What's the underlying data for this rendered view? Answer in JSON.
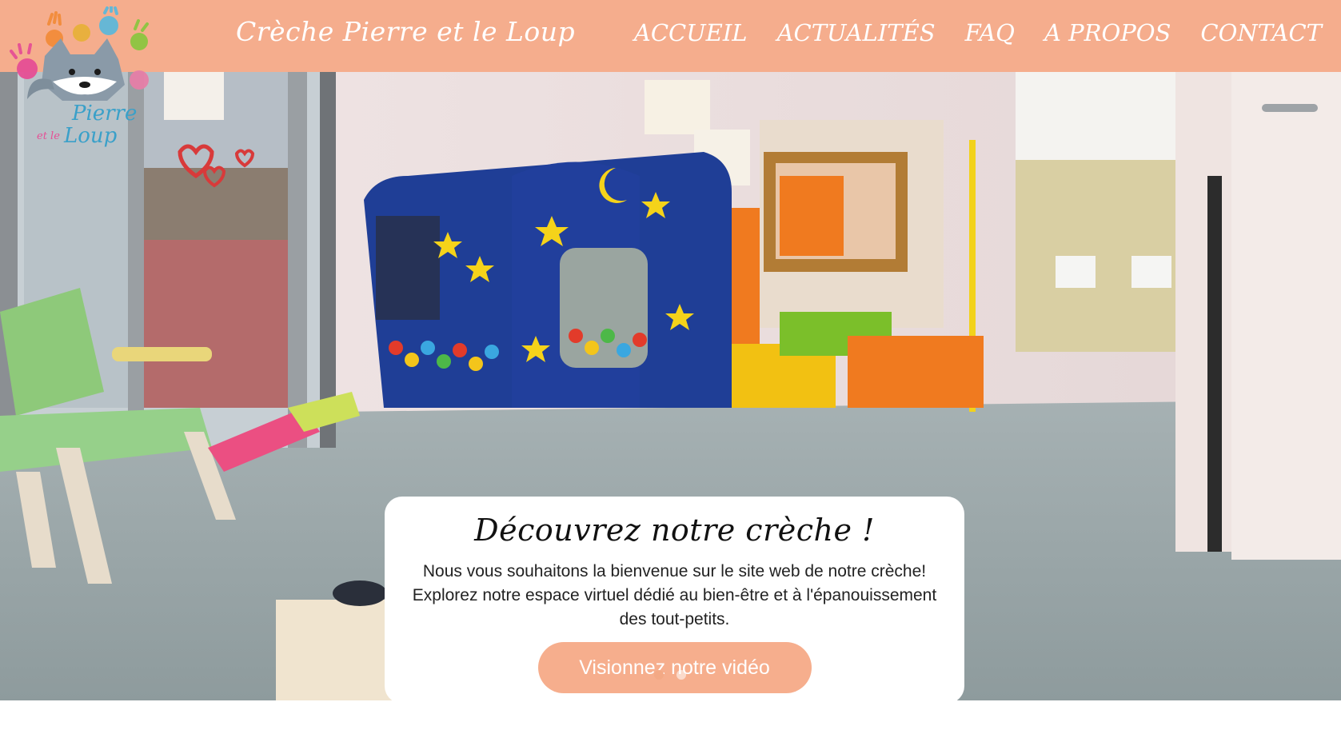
{
  "site": {
    "title": "Crèche Pierre et le Loup",
    "logo_text_line1": "Pierre",
    "logo_text_line2": "Loup",
    "logo_text_small": "et le"
  },
  "nav": {
    "items": [
      {
        "label": "ACCUEIL"
      },
      {
        "label": "ACTUALITÉS"
      },
      {
        "label": "FAQ"
      },
      {
        "label": "A PROPOS"
      },
      {
        "label": "CONTACT"
      }
    ]
  },
  "hero": {
    "card": {
      "title": "Découvrez notre crèche !",
      "text": "Nous vous souhaitons la bienvenue sur le site web de notre crèche! Explorez notre espace virtuel dédié au bien-être et à l'épanouissement des tout-petits.",
      "button_label": "Visionnez notre vidéo"
    },
    "slider": {
      "total_slides": 2,
      "active_slide": 1
    }
  },
  "colors": {
    "header_bg": "#f5ad8d",
    "accent": "#f6ae8d",
    "text_dark": "#111111"
  },
  "icons": {
    "logo": "wolf-with-hands-logo",
    "slide_indicators": "dots"
  }
}
